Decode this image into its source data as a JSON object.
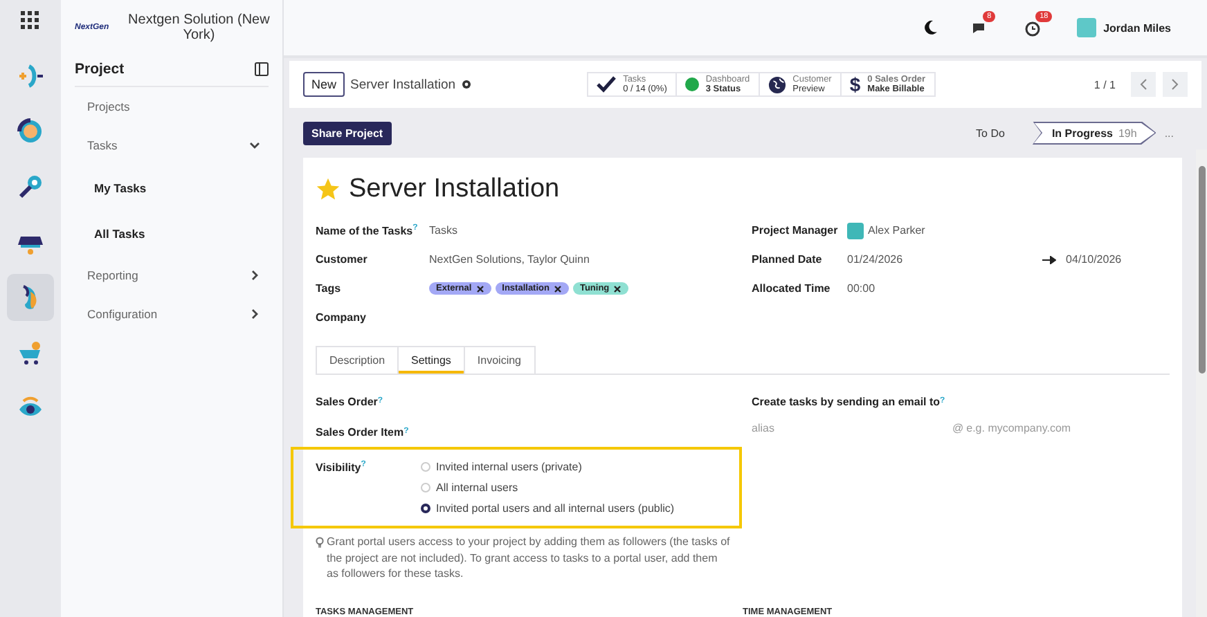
{
  "rail": {
    "apps": [
      {
        "kind": "plusminus",
        "selected": false
      },
      {
        "kind": "coin",
        "selected": false
      },
      {
        "kind": "key",
        "selected": false
      },
      {
        "kind": "stand",
        "selected": false
      },
      {
        "kind": "swirl",
        "selected": true
      },
      {
        "kind": "cart",
        "selected": false
      },
      {
        "kind": "eye",
        "selected": false
      }
    ]
  },
  "company": {
    "logo_text": "NextGen",
    "name": "Nextgen Solution (New York)"
  },
  "sidebar": {
    "title": "Project",
    "items": [
      {
        "label": "Projects"
      },
      {
        "label": "Tasks",
        "expanded": true,
        "children": [
          {
            "label": "My Tasks"
          },
          {
            "label": "All Tasks"
          }
        ]
      },
      {
        "label": "Reporting",
        "expanded": false
      },
      {
        "label": "Configuration",
        "expanded": false
      }
    ]
  },
  "topbar": {
    "chat_badge": "8",
    "activity_badge": "18",
    "user": "Jordan Miles"
  },
  "control_panel": {
    "new_button": "New",
    "breadcrumb": "Server Installation",
    "stat_buttons": [
      {
        "kind": "check",
        "line1": "Tasks",
        "line2": "0 / 14 (0%)"
      },
      {
        "kind": "dot",
        "line1": "Dashboard",
        "line2": "3 Status"
      },
      {
        "kind": "globe",
        "line1": "Customer",
        "line2": "Preview"
      },
      {
        "kind": "dollar",
        "icon": "$",
        "line1": "0 Sales Order",
        "line2": "Make Billable"
      }
    ],
    "pager": "1 / 1"
  },
  "share_button": "Share Project",
  "stages": [
    {
      "label": "To Do",
      "selected": false
    },
    {
      "label": "In Progress",
      "selected": true,
      "duration": "19h"
    }
  ],
  "stages_more": "...",
  "form": {
    "starred": true,
    "title": "Server Installation",
    "left_fields": [
      {
        "label": "Name of the Tasks",
        "help": "?",
        "kind": "text",
        "value": "Tasks"
      },
      {
        "label": "Customer",
        "kind": "text",
        "value": "NextGen Solutions, Taylor Quinn"
      },
      {
        "label": "Tags",
        "kind": "tags",
        "tags": [
          {
            "label": "External",
            "color": "#a3a8f5"
          },
          {
            "label": "Installation",
            "color": "#a3a8f5"
          },
          {
            "label": "Tuning",
            "color": "#8fe0d2"
          }
        ]
      },
      {
        "label": "Company",
        "kind": "text"
      }
    ],
    "right_fields": [
      {
        "label": "Project Manager",
        "kind": "user",
        "value": "Alex Parker"
      },
      {
        "label": "Planned Date",
        "kind": "range",
        "value": "01/24/2026",
        "end": "04/10/2026"
      },
      {
        "label": "Allocated Time",
        "kind": "text",
        "value": "00:00"
      }
    ],
    "tabs": [
      {
        "label": "Description",
        "selected": false
      },
      {
        "label": "Settings",
        "selected": true
      },
      {
        "label": "Invoicing",
        "selected": false
      }
    ],
    "settings": {
      "sales_order": {
        "label": "Sales Order",
        "help": "?"
      },
      "sales_order_item": {
        "label": "Sales Order Item",
        "help": "?"
      },
      "visibility": {
        "label": "Visibility",
        "help": "?"
      },
      "visibility_options": [
        {
          "label": "Invited internal users (private)",
          "selected": false
        },
        {
          "label": "All internal users",
          "selected": false
        },
        {
          "label": "Invited portal users and all internal users (public)",
          "selected": true
        }
      ],
      "hint": "Grant portal users access to your project by adding them as followers (the tasks of the project are not included). To grant access to tasks to a portal user, add them as followers for these tasks.",
      "email": {
        "label": "Create tasks by sending an email to",
        "help": "?"
      },
      "alias_placeholder": "alias",
      "domain_icon": "@",
      "domain_placeholder": "e.g. mycompany.com"
    },
    "sections": [
      "TASKS MANAGEMENT",
      "TIME MANAGEMENT"
    ]
  }
}
